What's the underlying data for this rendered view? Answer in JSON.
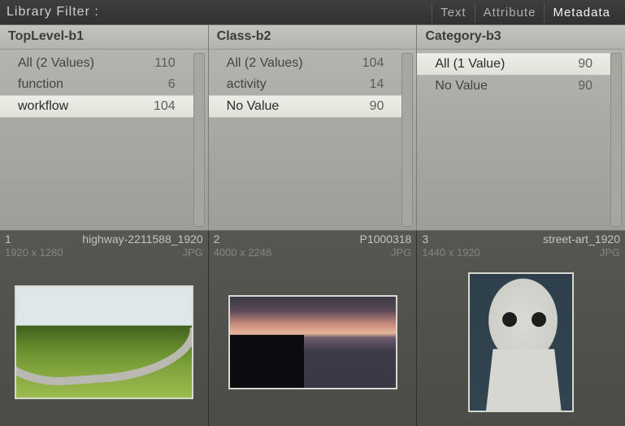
{
  "header": {
    "title": "Library Filter :",
    "tabs": [
      {
        "label": "Text",
        "active": false
      },
      {
        "label": "Attribute",
        "active": false
      },
      {
        "label": "Metadata",
        "active": true
      }
    ]
  },
  "panels": [
    {
      "title": "TopLevel-b1",
      "rows": [
        {
          "label": "All (2 Values)",
          "count": "110",
          "selected": false
        },
        {
          "label": "function",
          "count": "6",
          "selected": false
        },
        {
          "label": "workflow",
          "count": "104",
          "selected": true
        }
      ]
    },
    {
      "title": "Class-b2",
      "rows": [
        {
          "label": "All (2 Values)",
          "count": "104",
          "selected": false
        },
        {
          "label": "activity",
          "count": "14",
          "selected": false
        },
        {
          "label": "No Value",
          "count": "90",
          "selected": true
        }
      ]
    },
    {
      "title": "Category-b3",
      "rows": [
        {
          "label": "All (1 Value)",
          "count": "90",
          "selected": true
        },
        {
          "label": "No Value",
          "count": "90",
          "selected": false
        }
      ]
    }
  ],
  "thumbs": [
    {
      "index": "1",
      "name": "highway-2211588_1920",
      "dims": "1920 x 1280",
      "type": "JPG",
      "kind": "highway"
    },
    {
      "index": "2",
      "name": "P1000318",
      "dims": "4000 x 2248",
      "type": "JPG",
      "kind": "lake"
    },
    {
      "index": "3",
      "name": "street-art_1920",
      "dims": "1440 x 1920",
      "type": "JPG",
      "kind": "art"
    }
  ]
}
